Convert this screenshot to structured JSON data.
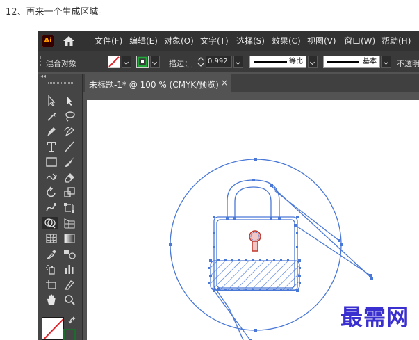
{
  "step_caption": "12、再来一个生成区域。",
  "app": {
    "logo_text": "Ai",
    "menu": [
      "文件(F)",
      "编辑(E)",
      "对象(O)",
      "文字(T)",
      "选择(S)",
      "效果(C)",
      "视图(V)",
      "窗口(W)",
      "帮助(H)"
    ]
  },
  "control_bar": {
    "selection_label": "混合对象",
    "stroke_label": "描边：",
    "stroke_value": "0.992",
    "stroke_profile_label": "等比",
    "brush_label": "基本",
    "opacity_label": "不透明度"
  },
  "document_tab": {
    "title": "未标题-1* @ 100 % (CMYK/预览)",
    "close": "×"
  },
  "toolbar": {
    "collapse": "◂◂",
    "tools": [
      "selection-tool",
      "direct-selection-tool",
      "magic-wand-tool",
      "lasso-tool",
      "pen-tool",
      "curvature-tool",
      "type-tool",
      "line-segment-tool",
      "rectangle-tool",
      "paintbrush-tool",
      "shaper-tool",
      "eraser-tool",
      "rotate-tool",
      "scale-tool",
      "warp-tool",
      "free-transform-tool",
      "shape-builder-tool",
      "perspective-grid-tool",
      "mesh-tool",
      "gradient-tool",
      "eyedropper-tool",
      "blend-tool",
      "symbol-sprayer-tool",
      "column-graph-tool",
      "artboard-tool",
      "slice-tool",
      "hand-tool",
      "zoom-tool"
    ],
    "active_tool": "shape-builder-tool"
  },
  "colors": {
    "path_blue": "#4a78d6",
    "keyhole_red": "#c0392b",
    "stroke_swatch_green": "#1e6b2e",
    "watermark": "#3a2fcf"
  },
  "watermark": "最需网"
}
